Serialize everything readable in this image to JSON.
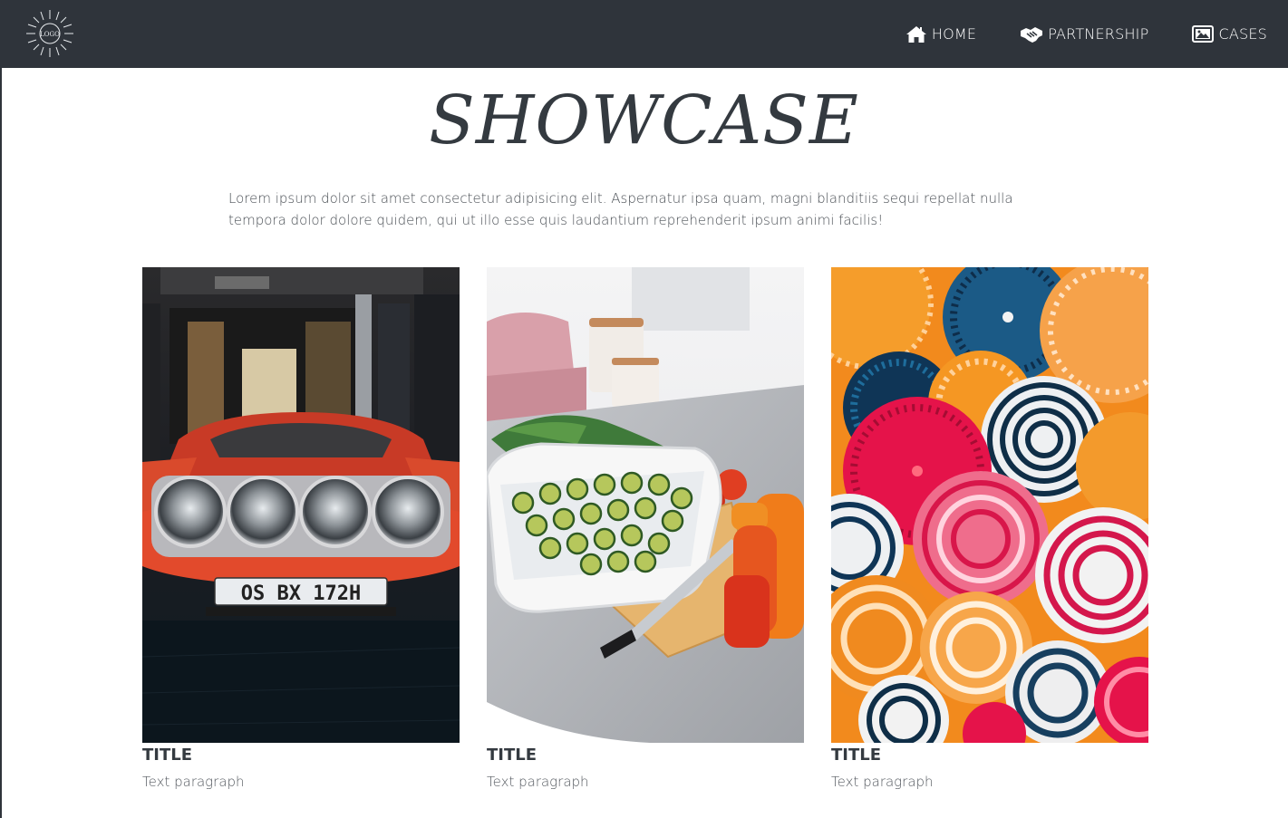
{
  "navbar": {
    "logo_text": "LOGO",
    "links": [
      {
        "label": "HOME",
        "icon": "home-icon"
      },
      {
        "label": "PARTNERSHIP",
        "icon": "handshake-icon"
      },
      {
        "label": "CASES",
        "icon": "images-icon"
      }
    ]
  },
  "main": {
    "title": "SHOWCASE",
    "intro": "Lorem ipsum dolor sit amet consectetur adipisicing elit. Aspernatur ipsa quam, magni blanditiis sequi repellat nulla tempora dolor dolore quidem, qui ut illo esse quis laudantium reprehenderit ipsum animi facilis!",
    "cards": [
      {
        "title": "TITLE",
        "text": "Text paragraph",
        "image": "red-rally-car-photo",
        "plate": "OS BX 172H"
      },
      {
        "title": "TITLE",
        "text": "Text paragraph",
        "image": "kitchen-zucchini-photo"
      },
      {
        "title": "TITLE",
        "text": "Text paragraph",
        "image": "paper-fans-photo"
      }
    ]
  },
  "colors": {
    "navbar_bg": "#2f343b",
    "text_dark": "#343a40",
    "nav_text": "#ffffff"
  }
}
